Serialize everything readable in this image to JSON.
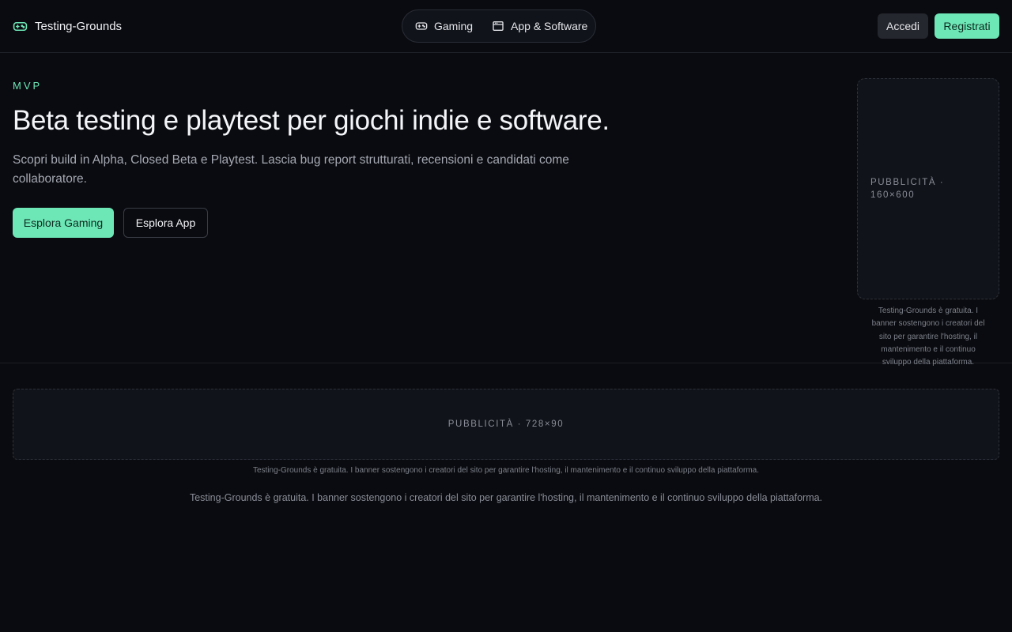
{
  "header": {
    "brand": "Testing-Grounds",
    "nav": [
      {
        "label": "Gaming",
        "icon": "gamepad-icon"
      },
      {
        "label": "App & Software",
        "icon": "app-window-icon"
      }
    ],
    "login_label": "Accedi",
    "register_label": "Registrati"
  },
  "hero": {
    "eyebrow": "MVP",
    "title": "Beta testing e playtest per giochi indie e software.",
    "subtitle": "Scopri build in Alpha, Closed Beta e Playtest. Lascia bug report strutturati, recensioni e candidati come collaboratore.",
    "cta_primary": "Esplora Gaming",
    "cta_secondary": "Esplora App"
  },
  "ads": {
    "vertical_label": "PUBBLICITÀ · 160×600",
    "vertical_note": "Testing-Grounds è gratuita. I banner sostengono i creatori del sito per garantire l'hosting, il mantenimento e il continuo sviluppo della piattaforma.",
    "horizontal_label": "PUBBLICITÀ · 728×90",
    "horizontal_note": "Testing-Grounds è gratuita. I banner sostengono i creatori del sito per garantire l'hosting, il mantenimento e il continuo sviluppo della piattaforma."
  },
  "footer": {
    "note": "Testing-Grounds è gratuita. I banner sostengono i creatori del sito per garantire l'hosting, il mantenimento e il continuo sviluppo della piattaforma."
  },
  "colors": {
    "background": "#0a0b10",
    "accent": "#6ee7b7",
    "muted_text": "#a6a9b3"
  }
}
